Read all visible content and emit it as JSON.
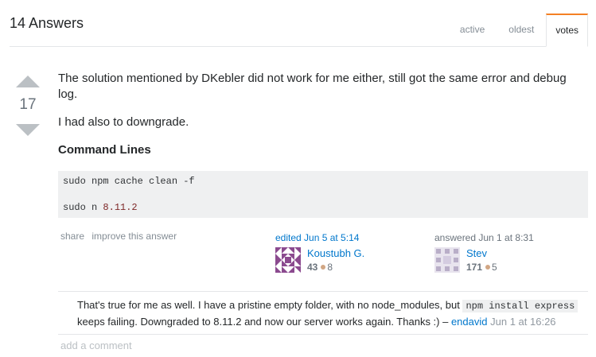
{
  "header": {
    "title": "14 Answers",
    "tabs": [
      {
        "label": "active",
        "selected": false
      },
      {
        "label": "oldest",
        "selected": false
      },
      {
        "label": "votes",
        "selected": true
      }
    ]
  },
  "answer": {
    "score": "17",
    "paragraphs": [
      "The solution mentioned by DKebler did not work for me either, still got the same error and debug log.",
      "I had also to downgrade."
    ],
    "heading": "Command Lines",
    "code": {
      "line1": "sudo npm cache clean -f",
      "line2_prefix": "sudo n ",
      "line2_number": "8.11.2"
    },
    "menu": {
      "share": "share",
      "improve": "improve this answer"
    },
    "editor": {
      "action": "edited Jun 5 at 5:14",
      "name": "Koustubh G.",
      "reputation": "43",
      "bronze": "8"
    },
    "author": {
      "action": "answered Jun 1 at 8:31",
      "name": "Stev",
      "reputation": "171",
      "bronze": "5"
    }
  },
  "comment": {
    "text_before": "That's true for me as well. I have a pristine empty folder, with no node_modules, but ",
    "code": "npm install express",
    "text_after": " keeps failing. Downgraded to 8.11.2 and now our server works again. Thanks :) – ",
    "user": "endavid",
    "date": "Jun 1 at 16:26"
  },
  "add_comment": "add a comment",
  "colors": {
    "accent": "#f48024",
    "link": "#0077cc",
    "bronze": "#d1a684"
  }
}
